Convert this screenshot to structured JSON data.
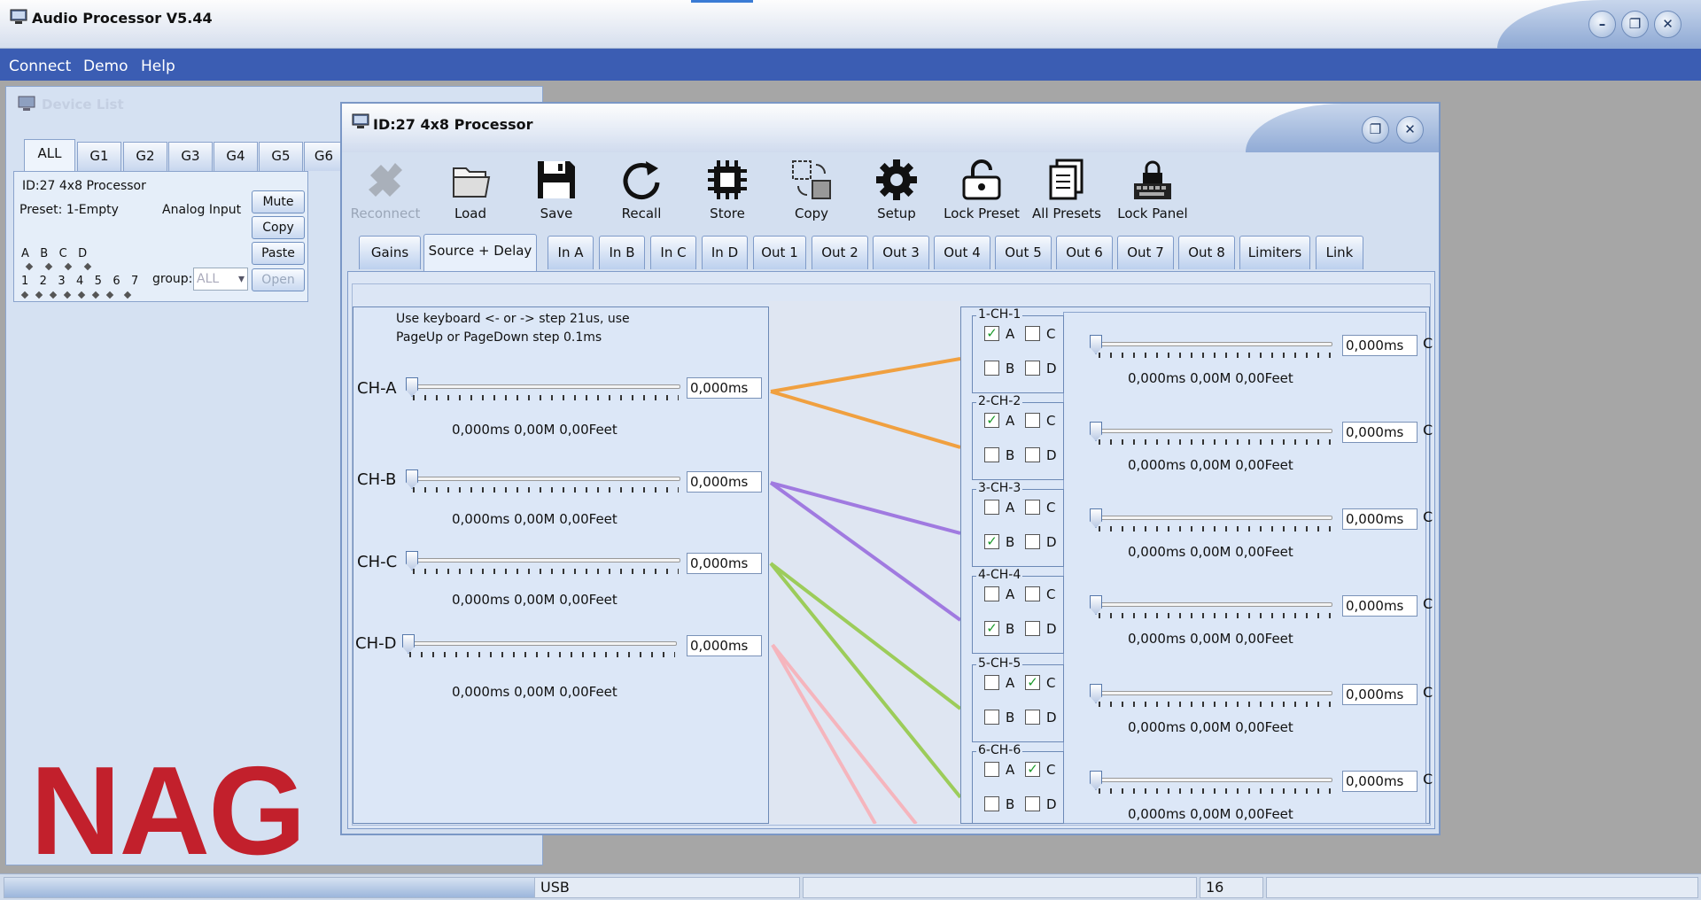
{
  "window": {
    "title": "Audio Processor V5.44",
    "controls": [
      "minimize-icon",
      "restore-icon",
      "close-icon"
    ]
  },
  "menu": {
    "items": [
      "Connect",
      "Demo",
      "Help"
    ]
  },
  "device_list": {
    "title": "Device List",
    "tabs": [
      "ALL",
      "G1",
      "G2",
      "G3",
      "G4",
      "G5",
      "G6"
    ],
    "active_tab": "ALL",
    "device": {
      "name": "ID:27   4x8 Processor",
      "preset": "Preset: 1-Empty",
      "input_mode": "Analog Input",
      "input_letters": "A   B   C   D",
      "output_numbers": "1   2   3   4   5   6   7",
      "group_label": "group:",
      "group_value": "ALL",
      "buttons": {
        "mute": "Mute",
        "copy": "Copy",
        "paste": "Paste",
        "open": "Open"
      }
    }
  },
  "processor": {
    "title": "ID:27  4x8 Processor",
    "toolbar": {
      "reconnect": "Reconnect",
      "load": "Load",
      "save": "Save",
      "recall": "Recall",
      "store": "Store",
      "copy": "Copy",
      "setup": "Setup",
      "lock_preset": "Lock Preset",
      "all_presets": "All Presets",
      "lock_panel": "Lock Panel"
    },
    "tabs": [
      "Gains",
      "Source + Delay",
      "In A",
      "In B",
      "In C",
      "In D",
      "Out 1",
      "Out 2",
      "Out 3",
      "Out 4",
      "Out 5",
      "Out 6",
      "Out 7",
      "Out 8",
      "Limiters",
      "Link"
    ],
    "active_tab": "Source + Delay",
    "hint_line1": "Use keyboard <- or -> step 21us, use",
    "hint_line2": "PageUp or PageDown step 0.1ms",
    "inputs": [
      {
        "label": "CH-A",
        "value": "0,000ms",
        "readout": "0,000ms 0,00M 0,00Feet",
        "color": "#f0a040"
      },
      {
        "label": "CH-B",
        "value": "0,000ms",
        "readout": "0,000ms 0,00M 0,00Feet",
        "color": "#a07ae0"
      },
      {
        "label": "CH-C",
        "value": "0,000ms",
        "readout": "0,000ms 0,00M 0,00Feet",
        "color": "#9ccc5a"
      },
      {
        "label": "CH-D",
        "value": "0,000ms",
        "readout": "0,000ms 0,00M 0,00Feet",
        "color": "#f5b5bd"
      }
    ],
    "outputs": [
      {
        "label": "1-CH-1",
        "A": true,
        "B": false,
        "C": false,
        "D": false,
        "value": "0,000ms",
        "readout": "0,000ms 0,00M 0,00Feet"
      },
      {
        "label": "2-CH-2",
        "A": true,
        "B": false,
        "C": false,
        "D": false,
        "value": "0,000ms",
        "readout": "0,000ms 0,00M 0,00Feet"
      },
      {
        "label": "3-CH-3",
        "A": false,
        "B": true,
        "C": false,
        "D": false,
        "value": "0,000ms",
        "readout": "0,000ms 0,00M 0,00Feet"
      },
      {
        "label": "4-CH-4",
        "A": false,
        "B": true,
        "C": false,
        "D": false,
        "value": "0,000ms",
        "readout": "0,000ms 0,00M 0,00Feet"
      },
      {
        "label": "5-CH-5",
        "A": false,
        "B": false,
        "C": true,
        "D": false,
        "value": "0,000ms",
        "readout": "0,000ms 0,00M 0,00Feet"
      },
      {
        "label": "6-CH-6",
        "A": false,
        "B": false,
        "C": true,
        "D": false,
        "value": "0,000ms",
        "readout": "0,000ms 0,00M 0,00Feet"
      }
    ],
    "checkbox_letters": {
      "A": "A",
      "B": "B",
      "C": "C",
      "D": "D"
    },
    "clipped_char": "C"
  },
  "statusbar": {
    "port": "USB",
    "count": "16"
  },
  "logo": {
    "text": "NAG",
    "color": "#c2202c"
  }
}
